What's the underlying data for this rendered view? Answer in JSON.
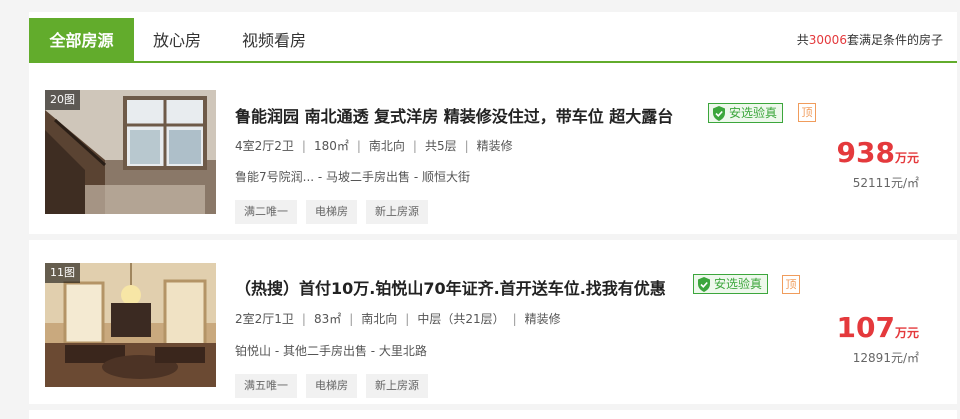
{
  "tabs": [
    {
      "label": "全部房源",
      "active": true
    },
    {
      "label": "放心房",
      "active": false
    },
    {
      "label": "视频看房",
      "active": false
    }
  ],
  "summary": {
    "prefix": "共",
    "count": "30006",
    "unit": "套",
    "suffix": "满足条件的房子"
  },
  "listings": [
    {
      "photo_count": "20图",
      "title": "鲁能润园 南北通透 复式洋房 精装修没住过，带车位 超大露台",
      "verified": "安选验真",
      "top_tag": "顶",
      "layout": "4室2厅2卫",
      "area": "180㎡",
      "orientation": "南北向",
      "floor": "共5层",
      "decoration": "精装修",
      "location": "鲁能7号院润... - 马坡二手房出售 - 顺恒大街",
      "tags": [
        "满二唯一",
        "电梯房",
        "新上房源"
      ],
      "price": "938",
      "price_unit": "万元",
      "unit_price": "52111元/㎡"
    },
    {
      "photo_count": "11图",
      "title": "（热搜）首付10万.铂悦山70年证齐.首开送车位.找我有优惠",
      "verified": "安选验真",
      "top_tag": "顶",
      "layout": "2室2厅1卫",
      "area": "83㎡",
      "orientation": "南北向",
      "floor": "中层（共21层）",
      "decoration": "精装修",
      "location": "铂悦山 - 其他二手房出售 - 大里北路",
      "tags": [
        "满五唯一",
        "电梯房",
        "新上房源"
      ],
      "price": "107",
      "price_unit": "万元",
      "unit_price": "12891元/㎡"
    }
  ],
  "colors": {
    "accent_green": "#62ac2c",
    "price_red": "#e4393c",
    "verified_green": "#3ca63c",
    "top_orange": "#f09c5c"
  },
  "icons": [
    "shield-check-icon"
  ]
}
